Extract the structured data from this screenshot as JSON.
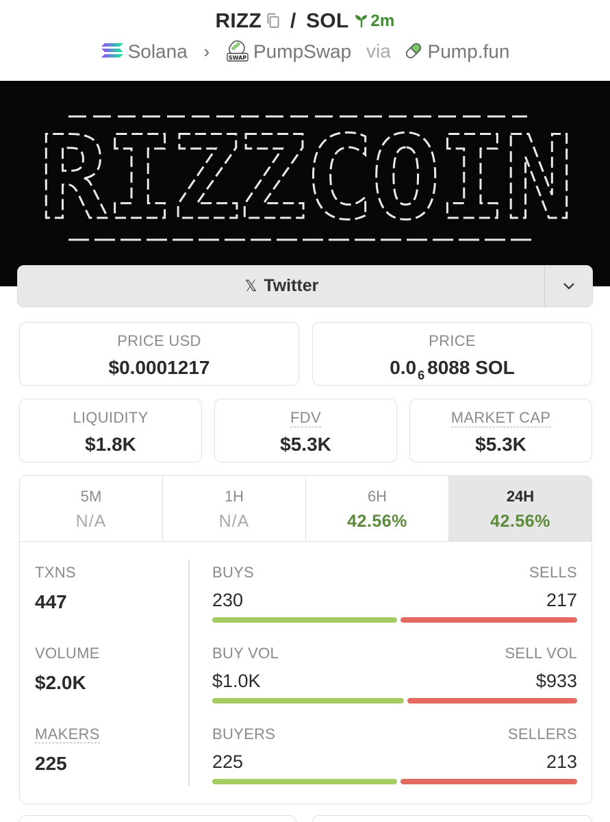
{
  "header": {
    "base": "RIZZ",
    "separator": "/",
    "quote": "SOL",
    "age": "2m",
    "chain": "Solana",
    "dex": "PumpSwap",
    "via": "via",
    "launchpad": "Pump.fun",
    "swap_badge": "SWAP"
  },
  "banner": {
    "text": "RIZZCOIN"
  },
  "links": {
    "twitter_label": "Twitter",
    "twitter_glyph": "𝕏"
  },
  "price": {
    "usd_label": "PRICE USD",
    "usd_value": "$0.0001217",
    "native_label": "PRICE",
    "native_prefix": "0.0",
    "native_zeros": "6",
    "native_digits": "8088 SOL"
  },
  "metrics": {
    "liquidity_label": "LIQUIDITY",
    "liquidity_value": "$1.8K",
    "fdv_label": "FDV",
    "fdv_value": "$5.3K",
    "mcap_label": "MARKET CAP",
    "mcap_value": "$5.3K"
  },
  "tabs": [
    {
      "label": "5M",
      "value": "N/A"
    },
    {
      "label": "1H",
      "value": "N/A"
    },
    {
      "label": "6H",
      "value": "42.56%"
    },
    {
      "label": "24H",
      "value": "42.56%"
    }
  ],
  "active_tab": "24H",
  "stats": {
    "txns_label": "TXNS",
    "txns_value": "447",
    "volume_label": "VOLUME",
    "volume_value": "$2.0K",
    "makers_label": "MAKERS",
    "makers_value": "225",
    "buys_label": "BUYS",
    "buys_value": "230",
    "sells_label": "SELLS",
    "sells_value": "217",
    "buy_vol_label": "BUY VOL",
    "buy_vol_value": "$1.0K",
    "sell_vol_label": "SELL VOL",
    "sell_vol_value": "$933",
    "buyers_label": "BUYERS",
    "buyers_value": "225",
    "sellers_label": "SELLERS",
    "sellers_value": "213",
    "buys_share": 0.51,
    "buy_vol_share": 0.53,
    "buyers_share": 0.51
  },
  "colors": {
    "positive": "#5c8a3a",
    "buy_bar": "#a3cc63",
    "sell_bar": "#e26a61",
    "age_green": "#3f8d2e"
  }
}
